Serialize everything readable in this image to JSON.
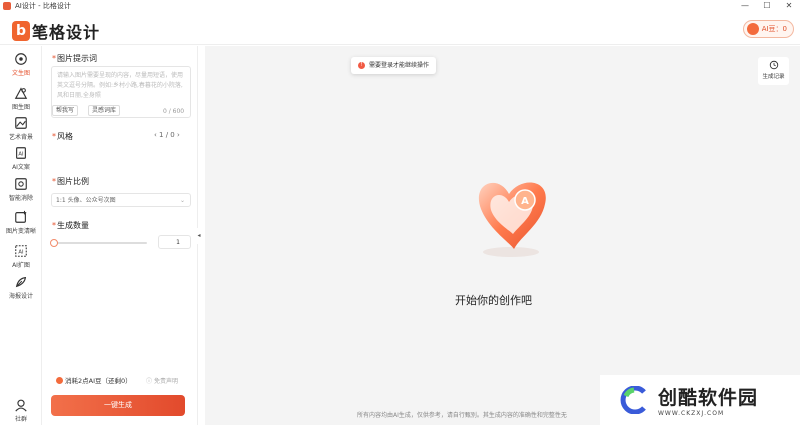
{
  "window": {
    "title": "AI设计 - 比格设计",
    "min": "—",
    "max": "☐",
    "close": "✕"
  },
  "header": {
    "brand_text": "笔格设计",
    "brand_letter": "b",
    "coin_label": "AI豆：0"
  },
  "sidebar": {
    "items": [
      {
        "label": "文生图",
        "icon": "text-image-icon"
      },
      {
        "label": "图生图",
        "icon": "image-image-icon"
      },
      {
        "label": "艺术背景",
        "icon": "art-background-icon"
      },
      {
        "label": "AI文案",
        "icon": "ai-copy-icon"
      },
      {
        "label": "智能消除",
        "icon": "smart-erase-icon"
      },
      {
        "label": "图片变清晰",
        "icon": "image-enhance-icon"
      },
      {
        "label": "AI扩图",
        "icon": "ai-expand-icon"
      },
      {
        "label": "海报设计",
        "icon": "poster-design-icon"
      }
    ],
    "community": "社群"
  },
  "panel": {
    "prompt_title": "图片提示词",
    "prompt_placeholder": "请输入图片需要呈现的内容，尽量用短语，使用英文逗号分隔。例如:乡村小路,春暮花的小院落,风和日丽,全身照",
    "help_write": "帮我写",
    "inspiration": "灵感词库",
    "prompt_count": "0 / 600",
    "style_title": "风格",
    "style_pager": "1 / 0",
    "ratio_title": "图片比例",
    "ratio_value": "1:1 头像、公众号次图",
    "quantity_title": "生成数量",
    "quantity_value": "1",
    "cost_text": "消耗2点AI豆（还剩0）",
    "free_text": "免责声明",
    "generate": "一键生成"
  },
  "main": {
    "toast": "需要登录才能继续操作",
    "history": "生成记录",
    "empty_text": "开始你的创作吧",
    "footer": "所有内容均由AI生成，仅供参考，请自行甄别。其生成内容的准确性和完整性无"
  },
  "watermark": {
    "title": "创酷软件园",
    "url": "WWW.CKZXJ.COM"
  },
  "colors": {
    "accent": "#e5532f",
    "button_start": "#f2704a",
    "button_end": "#e24a2c"
  }
}
